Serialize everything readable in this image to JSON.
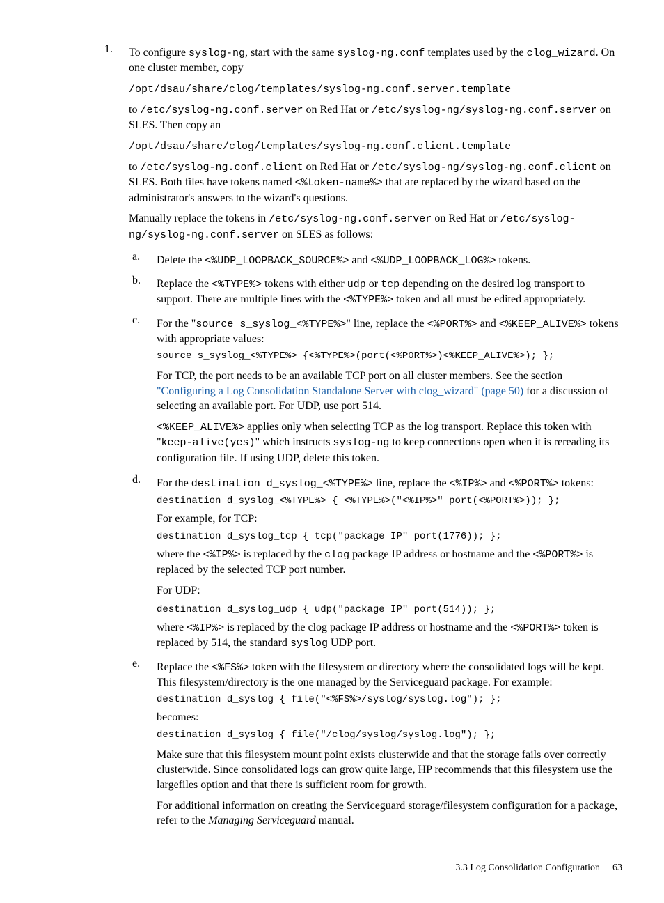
{
  "step1": {
    "marker": "1.",
    "p1a": "To configure ",
    "p1b": "syslog-ng",
    "p1c": ", start with the same ",
    "p1d": "syslog-ng.conf",
    "p1e": " templates used by the ",
    "p1f": "clog_wizard",
    "p1g": ". On one cluster member, copy",
    "path1": "/opt/dsau/share/clog/templates/syslog-ng.conf.server.template",
    "p2a": "to ",
    "p2b": "/etc/syslog-ng.conf.server",
    "p2c": " on Red Hat or ",
    "p2d": "/etc/syslog-ng/syslog-ng.conf.server",
    "p2e": " on SLES. Then copy an",
    "path2": "/opt/dsau/share/clog/templates/syslog-ng.conf.client.template",
    "p3a": "to ",
    "p3b": "/etc/syslog-ng.conf.client",
    "p3c": " on Red Hat or ",
    "p3d": "/etc/syslog-ng/syslog-ng.conf.client",
    "p3e": " on SLES. Both files have tokens named ",
    "p3f": "<%token-name%>",
    "p3g": " that are replaced by the wizard based on the administrator's answers to the wizard's questions.",
    "p4a": "Manually replace the tokens in ",
    "p4b": "/etc/syslog-ng.conf.server",
    "p4c": " on Red Hat or ",
    "p4d": "/etc/syslog-ng/syslog-ng.conf.server",
    "p4e": " on SLES as follows:"
  },
  "a": {
    "marker": "a.",
    "t1": "Delete the  ",
    "t2": "<%UDP_LOOPBACK_SOURCE%>",
    "t3": " and ",
    "t4": "<%UDP_LOOPBACK_LOG%>",
    "t5": " tokens."
  },
  "b": {
    "marker": "b.",
    "t1": "Replace the ",
    "t2": "<%TYPE%>",
    "t3": " tokens with either ",
    "t4": "udp",
    "t5": " or ",
    "t6": "tcp",
    "t7": " depending on the desired log transport to support. There are multiple lines with the ",
    "t8": "<%TYPE%>",
    "t9": " token and all must be edited appropriately."
  },
  "c": {
    "marker": "c.",
    "t1": "For the \"",
    "t2": "source s_syslog_<%TYPE%>",
    "t3": "\" line, replace the ",
    "t4": "<%PORT%>",
    "t5": " and ",
    "t6": "<%KEEP_ALIVE%>",
    "t7": " tokens with appropriate values:",
    "code1": "source s_syslog_<%TYPE%> {<%TYPE%>(port(<%PORT%>)<%KEEP_ALIVE%>); };",
    "p2a": "For TCP, the port needs to be an available TCP port on all cluster members. See the section ",
    "p2link": "\"Configuring a Log Consolidation Standalone Server with clog_wizard\" (page 50)",
    "p2b": " for a discussion of selecting an available port. For UDP, use port 514.",
    "p3a": "<%KEEP_ALIVE%>",
    "p3b": " applies only when selecting TCP as the log transport. Replace this token with \"",
    "p3c": "keep-alive(yes)",
    "p3d": "\" which instructs ",
    "p3e": "syslog-ng",
    "p3f": " to keep connections open when it is rereading its configuration file. If using UDP, delete this token."
  },
  "d": {
    "marker": "d.",
    "t1": "For the ",
    "t2": "destination d_syslog_<%TYPE%>",
    "t3": " line, replace the ",
    "t4": "<%IP%>",
    "t5": " and ",
    "t6": "<%PORT%>",
    "t7": " tokens:",
    "code1": "destination d_syslog_<%TYPE%> { <%TYPE%>(\"<%IP%>\" port(<%PORT%>)); };",
    "p2": "For example, for TCP:",
    "code2": "destination d_syslog_tcp { tcp(\"package IP\" port(1776)); };",
    "p3a": "where the ",
    "p3b": "<%IP%>",
    "p3c": " is replaced by the ",
    "p3d": "clog",
    "p3e": " package IP address or hostname and the ",
    "p3f": "<%PORT%>",
    "p3g": " is replaced by the selected TCP port number.",
    "p4": "For UDP:",
    "code3": "destination d_syslog_udp { udp(\"package IP\" port(514)); };",
    "p5a": "where ",
    "p5b": "<%IP%>",
    "p5c": " is replaced by the clog package IP address or hostname and the ",
    "p5d": "<%PORT%>",
    "p5e": " token is replaced by 514, the standard ",
    "p5f": "syslog",
    "p5g": " UDP port."
  },
  "e": {
    "marker": "e.",
    "t1": "Replace the ",
    "t2": "<%FS%>",
    "t3": " token with the filesystem or directory where the consolidated logs will be kept. This filesystem/directory is the one managed by the Serviceguard package. For example:",
    "code1": "destination d_syslog { file(\"<%FS%>/syslog/syslog.log\"); };",
    "p2": "becomes:",
    "code2": "destination d_syslog { file(\"/clog/syslog/syslog.log\"); };",
    "p3": "Make sure that this filesystem mount point exists clusterwide and that the storage fails over correctly clusterwide. Since consolidated logs can grow quite large, HP recommends that this filesystem use the largefiles option and that there is sufficient room for growth.",
    "p4a": "For additional information on creating the Serviceguard storage/filesystem configuration for a package, refer to the ",
    "p4b": "Managing Serviceguard",
    "p4c": " manual."
  },
  "footer": {
    "section": "3.3 Log Consolidation Configuration",
    "page": "63"
  }
}
